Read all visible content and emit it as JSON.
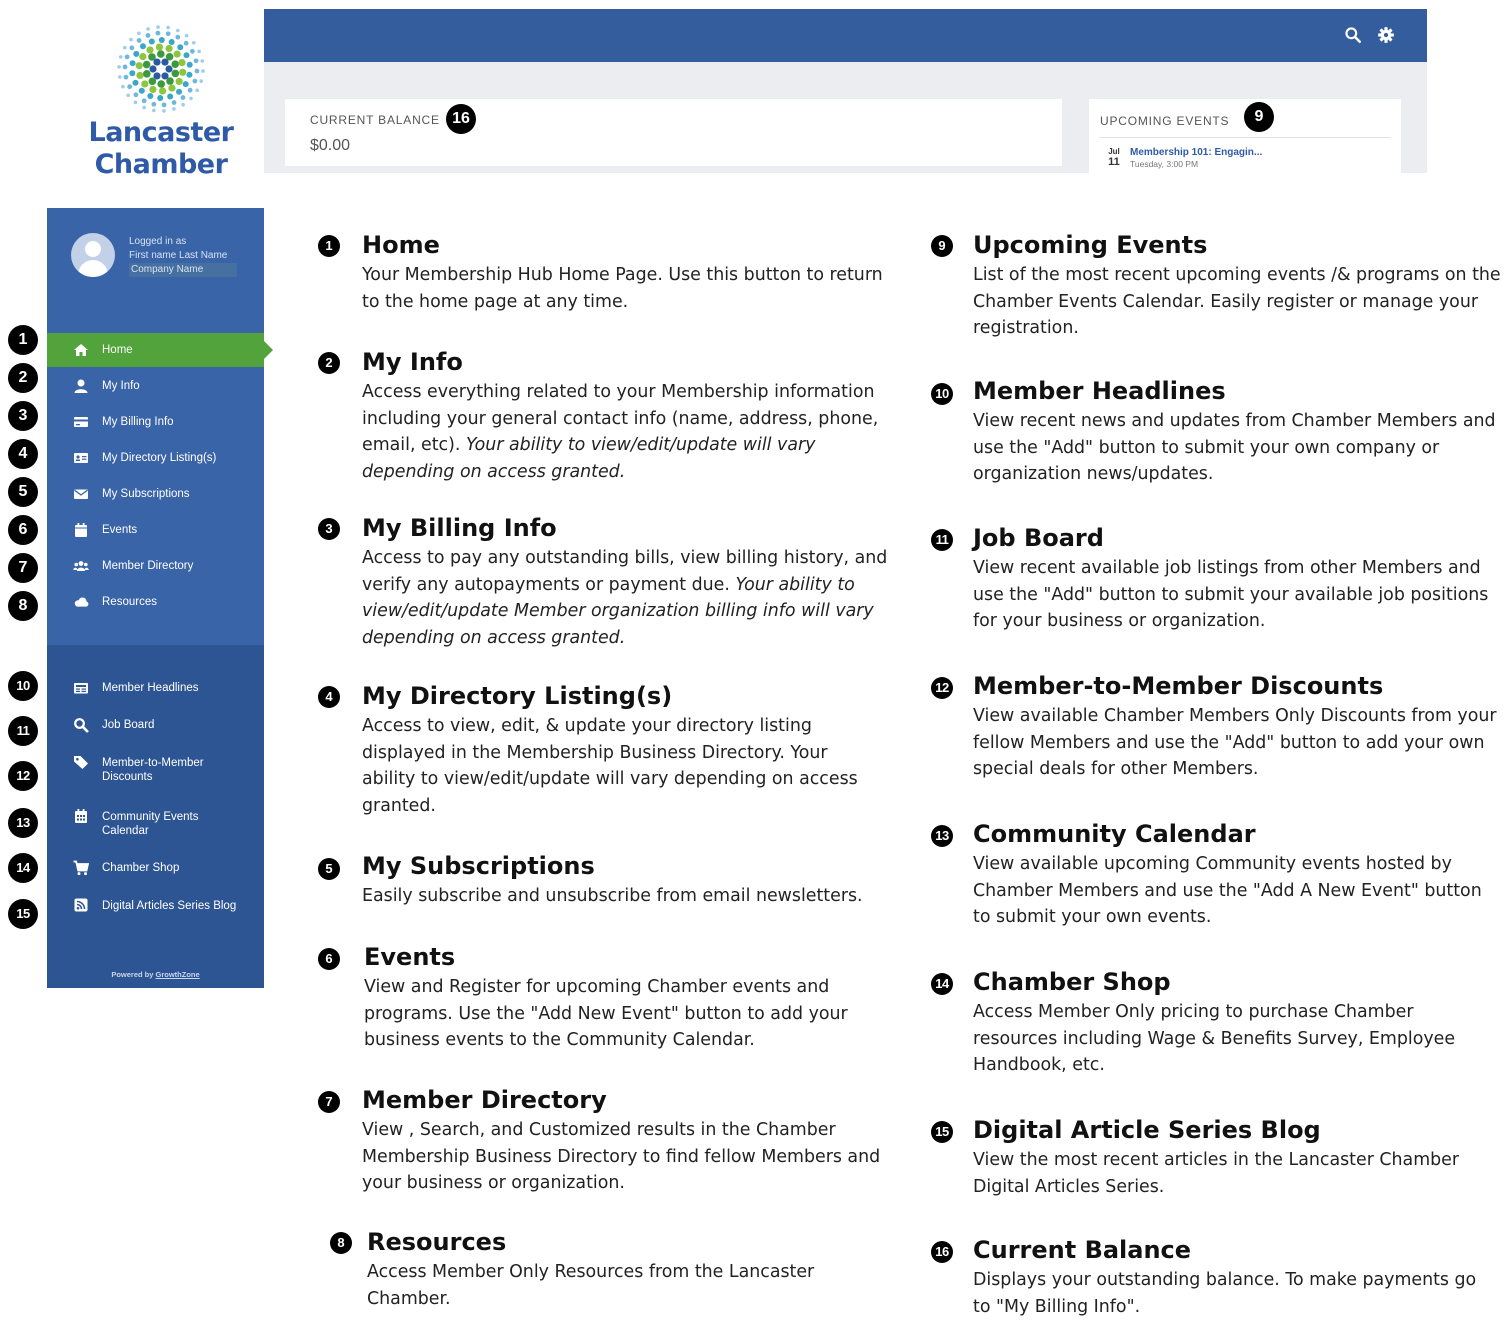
{
  "logo": {
    "line1": "Lancaster",
    "line2": "Chamber"
  },
  "user": {
    "logged_in": "Logged in as",
    "name": "First name Last Name",
    "company": "Company Name"
  },
  "nav": [
    {
      "num": "1",
      "label": "Home",
      "icon": "home-icon"
    },
    {
      "num": "2",
      "label": "My Info",
      "icon": "user-icon"
    },
    {
      "num": "3",
      "label": "My Billing Info",
      "icon": "credit-card-icon"
    },
    {
      "num": "4",
      "label": "My Directory Listing(s)",
      "icon": "id-card-icon"
    },
    {
      "num": "5",
      "label": "My Subscriptions",
      "icon": "envelope-icon"
    },
    {
      "num": "6",
      "label": "Events",
      "icon": "calendar-icon"
    },
    {
      "num": "7",
      "label": "Member Directory",
      "icon": "users-icon"
    },
    {
      "num": "8",
      "label": "Resources",
      "icon": "cloud-icon"
    },
    {
      "num": "10",
      "label": "Member Headlines",
      "icon": "newspaper-icon"
    },
    {
      "num": "11",
      "label": "Job Board",
      "icon": "search-icon"
    },
    {
      "num": "12",
      "label": "Member-to-Member Discounts",
      "icon": "tag-icon"
    },
    {
      "num": "13",
      "label": "Community Events Calendar",
      "icon": "calendar-grid-icon"
    },
    {
      "num": "14",
      "label": "Chamber Shop",
      "icon": "shopping-cart-icon"
    },
    {
      "num": "15",
      "label": "Digital Articles Series Blog",
      "icon": "rss-icon"
    }
  ],
  "powered": {
    "text": "Powered by",
    "link": "GrowthZone"
  },
  "balance": {
    "title": "CURRENT BALANCE",
    "num": "16",
    "value": "$0.00"
  },
  "events": {
    "title": "UPCOMING EVENTS",
    "num": "9",
    "month": "Jul",
    "day": "11",
    "event_title": "Membership 101: Engagin...",
    "event_time": "Tuesday, 3:00 PM"
  },
  "desc": [
    {
      "num": "1",
      "title": "Home",
      "text": "Your Membership Hub Home Page. Use this button to return to the home page at any time."
    },
    {
      "num": "2",
      "title": "My Info",
      "text": "Access everything related to your Membership information including your general contact info (name, address, phone, email, etc).",
      "italic": "Your ability to view/edit/update will vary depending on access granted."
    },
    {
      "num": "3",
      "title": "My Billing Info",
      "text": "Access to pay any outstanding bills, view billing history, and verify any autopayments or payment due.",
      "italic": "Your ability to view/edit/update Member organization billing info will vary depending on access granted."
    },
    {
      "num": "4",
      "title": "My Directory Listing(s)",
      "text": "Access to view, edit, & update your directory listing displayed in the Membership Business Directory. Your ability to view/edit/update will vary depending on access granted."
    },
    {
      "num": "5",
      "title": "My Subscriptions",
      "text": "Easily subscribe and unsubscribe from email newsletters."
    },
    {
      "num": "6",
      "title": "Events",
      "text": "View and Register for upcoming Chamber events and programs. Use the  \"Add New Event\" button to add your business events to the Community Calendar."
    },
    {
      "num": "7",
      "title": "Member Directory",
      "text": "View , Search, and Customized results in the Chamber Membership Business Directory to find fellow Members and your business or organization."
    },
    {
      "num": "8",
      "title": "Resources",
      "text": "Access Member Only Resources from the Lancaster Chamber."
    },
    {
      "num": "9",
      "title": "Upcoming Events",
      "text": "List of the most recent upcoming events /& programs on the Chamber Events Calendar.  Easily register or manage your registration."
    },
    {
      "num": "10",
      "title": "Member Headlines",
      "text": "View recent news and updates from Chamber Members and use the \"Add\" button to submit your own company or organization news/updates."
    },
    {
      "num": "11",
      "title": "Job Board",
      "text": "View recent available job listings from other Members and use the \"Add\" button to submit your available job positions for your business or organization."
    },
    {
      "num": "12",
      "title": "Member-to-Member Discounts",
      "text": "View available Chamber Members Only Discounts from your fellow Members and use the \"Add\" button to add your own special deals for other Members."
    },
    {
      "num": "13",
      "title": "Community Calendar",
      "text": "View available upcoming Community events hosted by Chamber Members and use the \"Add A New Event\" button to submit your own events."
    },
    {
      "num": "14",
      "title": "Chamber Shop",
      "text": "Access Member Only pricing to purchase Chamber resources including Wage & Benefits Survey, Employee Handbook, etc."
    },
    {
      "num": "15",
      "title": "Digital Article Series Blog",
      "text": "View the most recent articles in the Lancaster Chamber Digital Articles Series."
    },
    {
      "num": "16",
      "title": "Current Balance",
      "text": "Displays your outstanding balance.  To make payments go to \"My Billing Info\"."
    }
  ],
  "colors": {
    "primary": "#345d9e",
    "active": "#52a33b",
    "sidebar": "#3a64a8",
    "logo_text": "#2f5aa8"
  },
  "toolbar_icons": [
    "search-icon",
    "gear-icon"
  ]
}
